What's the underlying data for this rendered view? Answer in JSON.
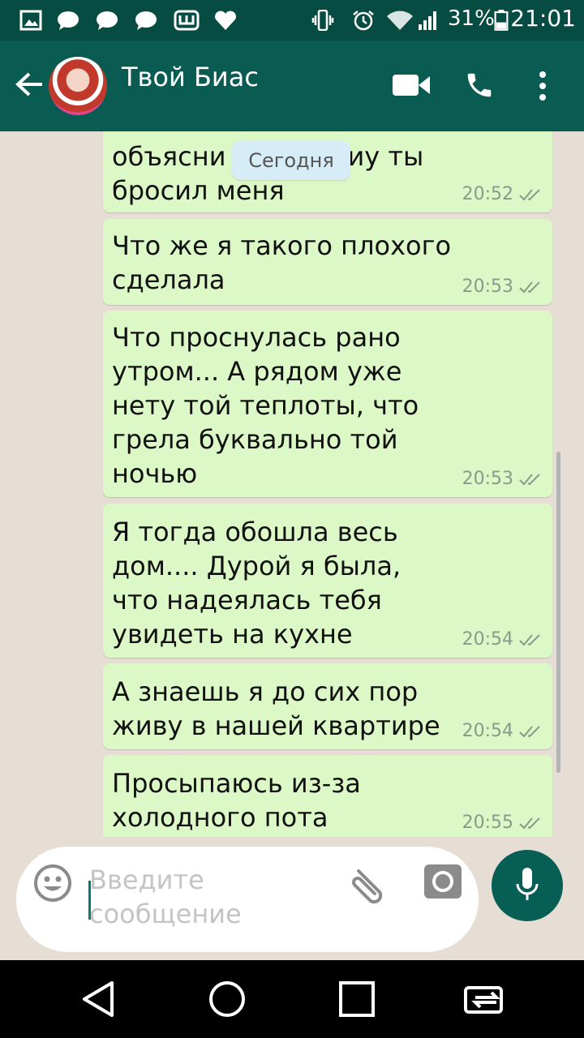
{
  "status_bar": {
    "icons": [
      "image-icon",
      "chat-bubble-icon",
      "chat-bubble-icon",
      "chat-bubble-icon",
      "w-app-icon",
      "heart-icon",
      "vibrate-icon",
      "alarm-icon",
      "wifi-icon",
      "signal-icon"
    ],
    "battery_percent": "31%",
    "time": "21:01"
  },
  "app_bar": {
    "contact_name": "Твой Биас",
    "icons": [
      "back-arrow-icon",
      "video-call-icon",
      "phone-icon",
      "more-vert-icon"
    ]
  },
  "chat": {
    "date_divider": "Сегодня",
    "messages": [
      {
        "text": "объяснил, почему ты\nбросил меня",
        "visible_text_start": "объясни",
        "visible_text_end": "иу ты",
        "time": "20:52",
        "status": "read"
      },
      {
        "text": "Что же я такого плохого\nсделала",
        "time": "20:53",
        "status": "read"
      },
      {
        "text": "Что проснулась рано\nутром... А рядом уже\nнету той теплоты, что\nгрела буквально той\nночью",
        "time": "20:53",
        "status": "read"
      },
      {
        "text": "Я тогда обошла весь\nдом.... Дурой я была,\nчто надеялась тебя\nувидеть на кухне",
        "time": "20:54",
        "status": "read"
      },
      {
        "text": "А знаешь я до сих пор\nживу в нашей квартире",
        "time": "20:54",
        "status": "read"
      },
      {
        "text": "Просыпаюсь из-за\nхолодного пота",
        "time": "20:55",
        "status": "read"
      }
    ]
  },
  "composer": {
    "placeholder": "Введите\nсообщение",
    "icons": [
      "emoji-icon",
      "attach-icon",
      "camera-icon",
      "mic-icon"
    ]
  },
  "nav_bar": {
    "icons": [
      "back-triangle-icon",
      "home-circle-icon",
      "recents-square-icon",
      "switch-app-icon"
    ]
  },
  "colors": {
    "header": "#0a5c52",
    "status_bar": "#074c42",
    "outgoing_bubble": "#dcf8c6",
    "chat_background": "#e6ddd4",
    "accent": "#075e54"
  }
}
